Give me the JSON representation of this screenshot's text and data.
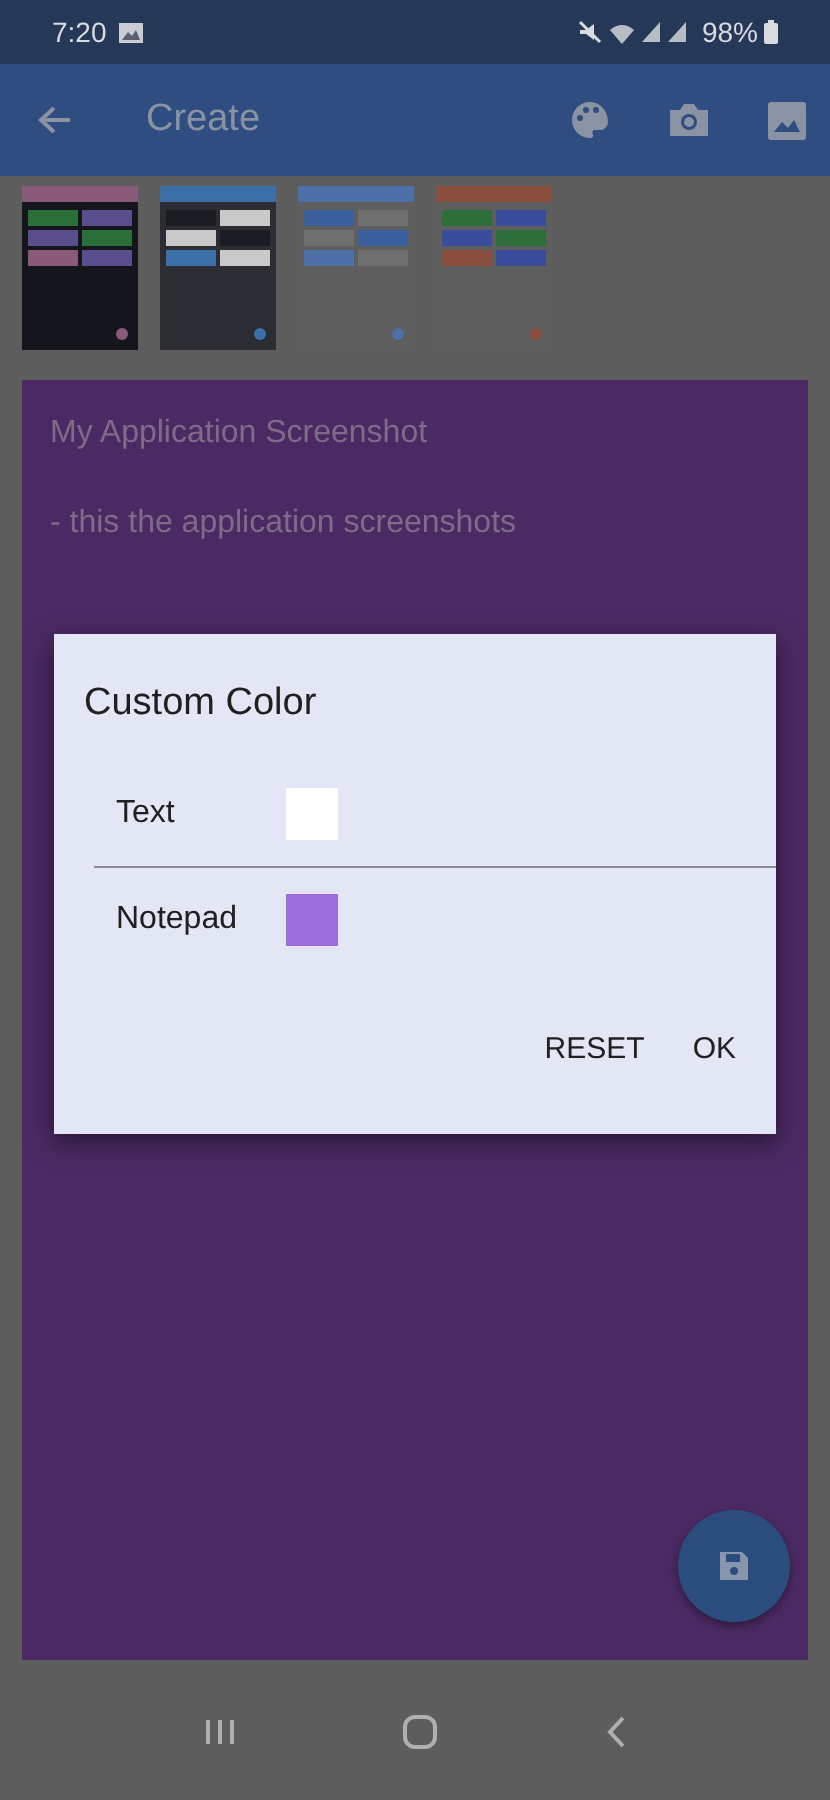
{
  "status_bar": {
    "time": "7:20",
    "battery": "98%"
  },
  "toolbar": {
    "title": "Create"
  },
  "note": {
    "title": "My Application Screenshot",
    "body": "- this the application screenshots"
  },
  "dialog": {
    "title": "Custom Color",
    "items": [
      {
        "label": "Text",
        "color": "#ffffff"
      },
      {
        "label": "Notepad",
        "color": "#9c6fdc"
      }
    ],
    "buttons": [
      "RESET",
      "OK"
    ]
  }
}
